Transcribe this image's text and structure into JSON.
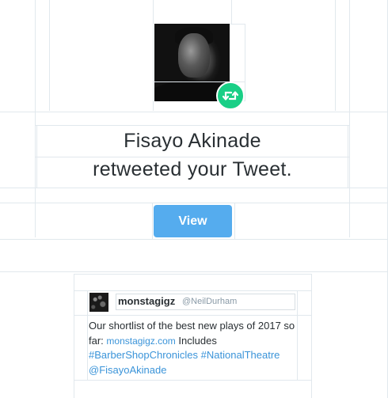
{
  "notification": {
    "actor_name": "Fisayo Akinade",
    "action_text": "retweeted your Tweet.",
    "view_button_label": "View",
    "badge_color": "#19cf86",
    "button_color": "#55acee"
  },
  "tweet": {
    "display_name": "monstagigz",
    "handle": "@NeilDurham",
    "text_part1": "Our shortlist of the best new plays of 2017 so far: ",
    "link_domain": "monstagigz.com",
    "text_part2": " Includes ",
    "hashtag1": "#BarberShopChronicles",
    "hashtag2": "#NationalTheatre",
    "mention": "@FisayoAkinade"
  }
}
